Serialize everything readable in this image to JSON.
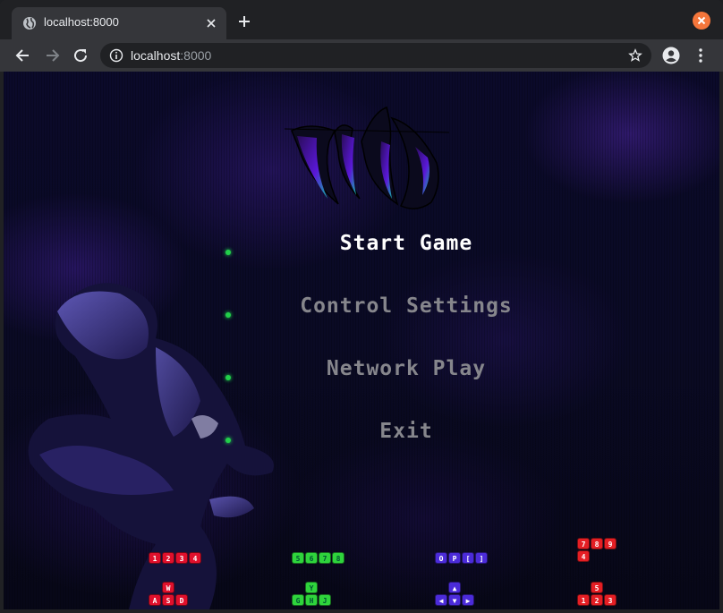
{
  "browser": {
    "tab_title": "localhost:8000",
    "url_host": "localhost",
    "url_port": ":8000",
    "icons": [
      "globe-icon",
      "close-icon",
      "plus-icon",
      "back-icon",
      "forward-icon",
      "reload-icon",
      "info-icon",
      "star-icon",
      "profile-icon",
      "menu-icon"
    ]
  },
  "game": {
    "menu": [
      {
        "label": "Start Game",
        "state": "selected"
      },
      {
        "label": "Control Settings",
        "state": "normal"
      },
      {
        "label": "Network Play",
        "state": "normal"
      },
      {
        "label": "Exit",
        "state": "normal"
      }
    ],
    "colors": {
      "selected": "#ffffff",
      "normal": "#86868c",
      "marker": "#22d04a",
      "player1": "#e0102c",
      "player2": "#2fd43c",
      "player3": "#4b2bd9",
      "player4": "#e41e24"
    },
    "control_keys": [
      {
        "player": 1,
        "top": [
          "1",
          "2",
          "3",
          "4"
        ],
        "bottom_top": [
          "W"
        ],
        "bottom": [
          "A",
          "S",
          "D"
        ]
      },
      {
        "player": 2,
        "top": [
          "5",
          "6",
          "7",
          "8"
        ],
        "bottom_top": [
          "Y"
        ],
        "bottom": [
          "G",
          "H",
          "J"
        ]
      },
      {
        "player": 3,
        "top": [
          "O",
          "P",
          "[",
          "]"
        ],
        "bottom_top": [
          "▲"
        ],
        "bottom": [
          "◀",
          "▼",
          "▶"
        ]
      },
      {
        "player": 4,
        "top": [
          "7",
          "8",
          "9"
        ],
        "top2": [
          "4"
        ],
        "bottom_top": [
          "5"
        ],
        "bottom": [
          "1",
          "2",
          "3"
        ]
      }
    ]
  }
}
